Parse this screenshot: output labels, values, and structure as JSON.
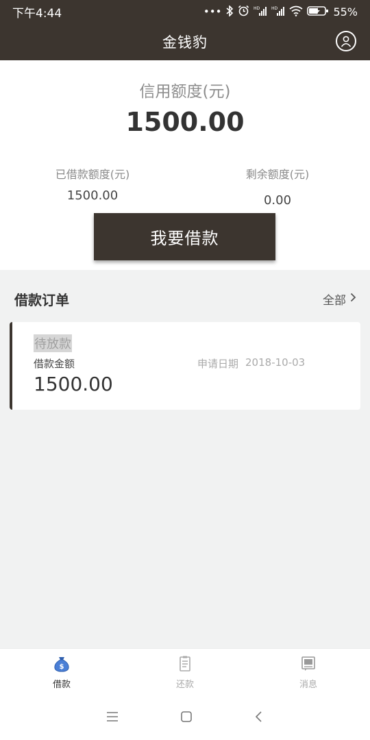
{
  "status_bar": {
    "time": "下午4:44",
    "battery": "55%",
    "icons": [
      "more-dots-icon",
      "bluetooth-icon",
      "alarm-icon",
      "signal-hd-icon",
      "signal-hd-icon",
      "wifi-icon",
      "battery-charging-icon"
    ]
  },
  "header": {
    "title": "金钱豹",
    "profile_icon": "user-profile-icon"
  },
  "credit": {
    "label": "信用额度(元)",
    "value": "1500.00",
    "borrowed_label": "已借款额度(元)",
    "borrowed_value": "1500.00",
    "remaining_label": "剩余额度(元)",
    "remaining_value": "0.00",
    "button_label": "我要借款"
  },
  "orders": {
    "title": "借款订单",
    "all_label": "全部",
    "items": [
      {
        "status": "待放款",
        "amount_label": "借款金额",
        "amount": "1500.00",
        "date_label": "申请日期",
        "date": "2018-10-03"
      }
    ]
  },
  "tabs": [
    {
      "label": "借款",
      "icon": "money-bag-icon",
      "active": true
    },
    {
      "label": "还款",
      "icon": "receipt-icon",
      "active": false
    },
    {
      "label": "消息",
      "icon": "message-icon",
      "active": false
    }
  ],
  "colors": {
    "primary": "#3c352f",
    "active_tab_icon": "#4a7fd6",
    "background": "#f1f2f2"
  }
}
